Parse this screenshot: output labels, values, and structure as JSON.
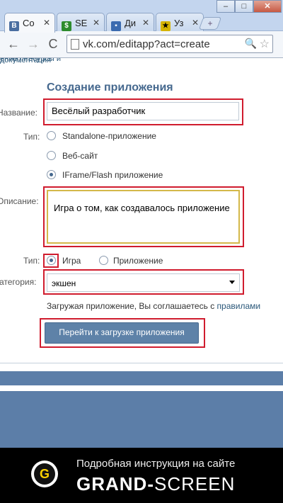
{
  "browser": {
    "tabs": [
      {
        "label": "Со",
        "favicon": "vk-icon",
        "color": "#4a6ea0"
      },
      {
        "label": "SE",
        "favicon": "seo-icon",
        "color": "#2d8b2d"
      },
      {
        "label": "Ди",
        "favicon": "chat-icon",
        "color": "#3b6bb0"
      },
      {
        "label": "Уз",
        "favicon": "bookmark-icon",
        "color": "#d6b400"
      }
    ],
    "new_tab_symbol": "+",
    "window_buttons": {
      "minimize": "–",
      "maximize": "□",
      "close": "✕"
    },
    "address": "vk.com/editapp?act=create",
    "nav": {
      "back": "←",
      "forward": "→",
      "reload": "C"
    }
  },
  "page": {
    "breadcrumb_cut": "ение | Ресурсы и документация",
    "title": "Создание приложения",
    "form": {
      "name_label": "Название:",
      "name_value": "Весёлый разработчик",
      "type_label": "Тип:",
      "type_options": [
        "Standalone-приложение",
        "Веб-сайт",
        "IFrame/Flash приложение"
      ],
      "type_selected": 2,
      "description_label": "Описание:",
      "description_value": "Игра о том, как создавалось приложение",
      "kind_label": "Тип:",
      "kind_options": [
        "Игра",
        "Приложение"
      ],
      "kind_selected": 0,
      "category_label": "Категория:",
      "category_value": "экшен",
      "terms_text": "Загружая приложение, Вы соглашаетесь с",
      "terms_link": "правилами",
      "submit_label": "Перейти к загрузке приложения"
    }
  },
  "footer": {
    "caption": "Подробная инструкция на сайте",
    "brand_bold": "GRAND-",
    "brand_rest": "SCREEN",
    "logo_letter": "G"
  }
}
